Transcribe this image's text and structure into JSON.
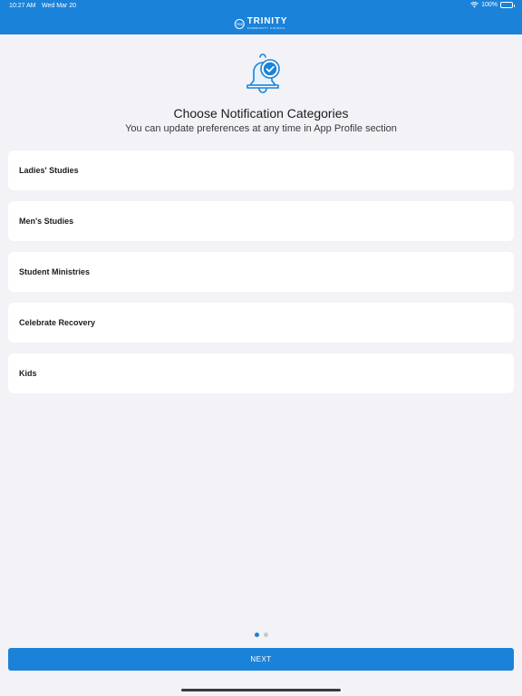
{
  "status_bar": {
    "time": "10:27 AM",
    "date": "Wed Mar 20",
    "battery": "100%",
    "battery_level": 1.0,
    "wifi_icon": "wifi-icon"
  },
  "header": {
    "logo_seal": "TCC",
    "logo_main": "TRINITY",
    "logo_sub": "COMMUNITY CHURCH",
    "background": "#1b82d9"
  },
  "main": {
    "icon": "bell-check-icon",
    "title": "Choose Notification Categories",
    "subtitle": "You can update preferences at any time in App Profile section",
    "categories": [
      {
        "label": "Ladies' Studies"
      },
      {
        "label": "Men's Studies"
      },
      {
        "label": "Student Ministries"
      },
      {
        "label": "Celebrate Recovery"
      },
      {
        "label": "Kids"
      }
    ]
  },
  "pager": {
    "total": 2,
    "current": 1
  },
  "footer": {
    "next_label": "NEXT",
    "accent": "#1b82d9"
  }
}
